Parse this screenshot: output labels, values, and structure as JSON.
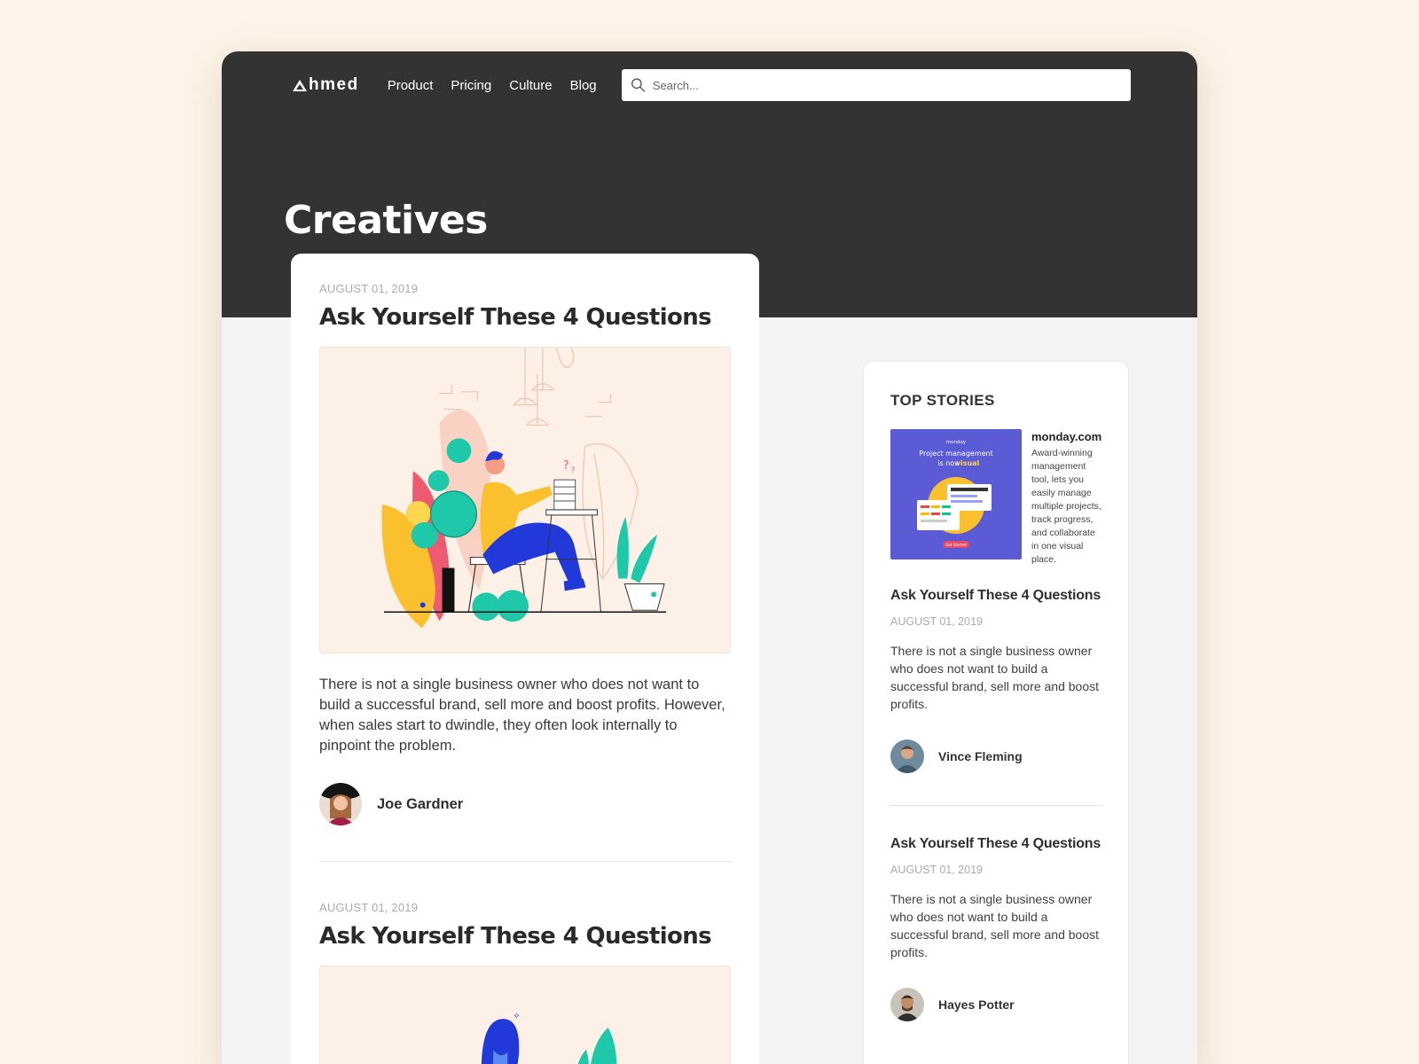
{
  "nav": {
    "logo_text": "hmed",
    "links": [
      {
        "label": "Product"
      },
      {
        "label": "Pricing"
      },
      {
        "label": "Culture"
      },
      {
        "label": "Blog"
      }
    ],
    "search_placeholder": "Search..."
  },
  "page_title": "Creatives",
  "posts": [
    {
      "date": "AUGUST 01, 2019",
      "title": "Ask Yourself These 4 Questions",
      "excerpt": "There is not a single business owner who does not want to build a successful brand, sell more and boost profits. However, when sales start to dwindle, they often look internally to pinpoint the problem.",
      "author": "Joe Gardner"
    },
    {
      "date": "AUGUST 01, 2019",
      "title": "Ask Yourself These 4 Questions"
    }
  ],
  "sidebar": {
    "heading": "TOP STORIES",
    "ad": {
      "brand": "monday.com",
      "description": "Award-winning management tool, lets you easily manage multiple projects, track progress, and collaborate in one visual place.",
      "image_logo": "monday",
      "image_headline": "Project management",
      "image_headline2": "is now",
      "image_highlight": "visual",
      "image_button": "Get Started"
    },
    "stories": [
      {
        "title": "Ask Yourself These 4 Questions",
        "date": "AUGUST 01, 2019",
        "excerpt": "There is not a single business owner who does not want to build a successful brand, sell more and boost profits.",
        "author": "Vince Fleming"
      },
      {
        "title": "Ask Yourself These 4 Questions",
        "date": "AUGUST 01, 2019",
        "excerpt": "There is not a single business owner who does not want to build a successful brand, sell more and boost profits.",
        "author": "Hayes Potter"
      }
    ]
  },
  "colors": {
    "page_background": "#fdf3e8",
    "header_dark": "#333333",
    "content_background": "#f3f3f3",
    "illustration_background": "#fdf0e6",
    "ad_purple": "#5b5bd6"
  }
}
